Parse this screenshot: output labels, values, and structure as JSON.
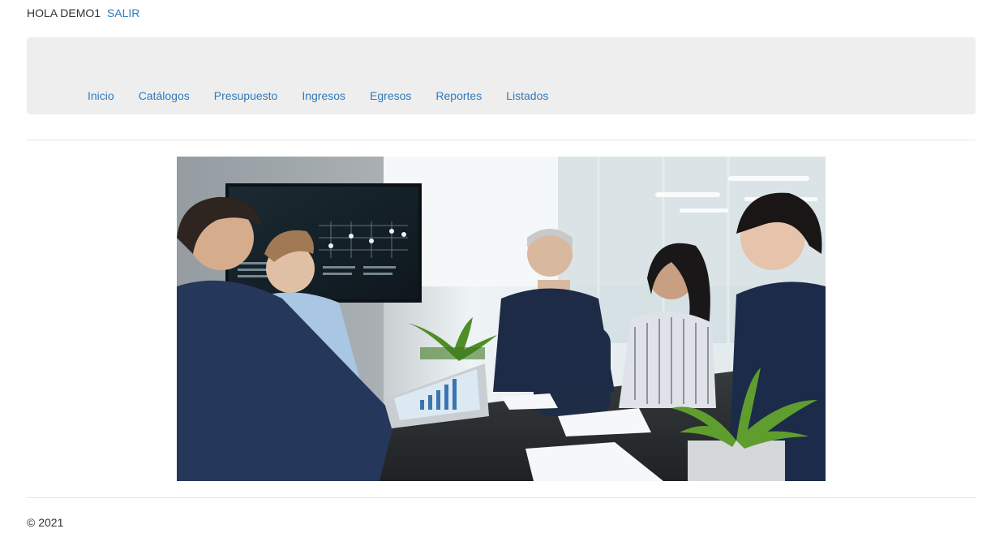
{
  "header": {
    "greeting": "HOLA DEMO1",
    "logout_label": "SALIR"
  },
  "nav": {
    "items": [
      {
        "label": "Inicio"
      },
      {
        "label": "Catálogos"
      },
      {
        "label": "Presupuesto"
      },
      {
        "label": "Ingresos"
      },
      {
        "label": "Egresos"
      },
      {
        "label": "Reportes"
      },
      {
        "label": "Listados"
      }
    ]
  },
  "hero": {
    "image_name": "meeting-photo"
  },
  "footer": {
    "copyright": "© 2021"
  },
  "colors": {
    "link": "#337ab7",
    "navbar_bg": "#eeeeee",
    "text": "#333333"
  }
}
